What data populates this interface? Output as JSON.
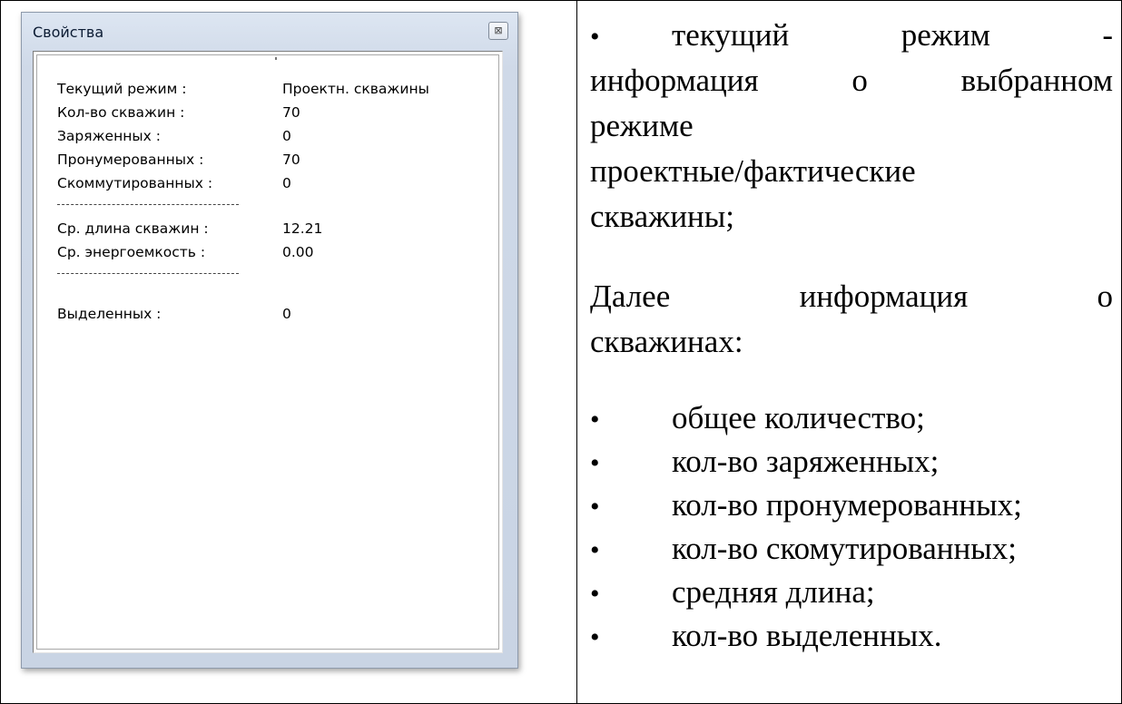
{
  "properties_window": {
    "title": "Свойства",
    "close_label": "⊠",
    "rows": [
      {
        "label": "Текущий режим :",
        "value": "Проектн. скважины"
      },
      {
        "label": "Кол-во скважин :",
        "value": "70"
      },
      {
        "label": "Заряженных :",
        "value": "0"
      },
      {
        "label": "Пронумерованных :",
        "value": "70"
      },
      {
        "label": "Скоммутированных :",
        "value": "0"
      },
      {
        "label": "Ср. длина скважин :",
        "value": "12.21"
      },
      {
        "label": "Ср. энергоемкость :",
        "value": "0.00"
      },
      {
        "label": "Выделенных :",
        "value": "0"
      }
    ],
    "separator_text": "--------------------------------"
  },
  "description": {
    "bullet_symbol": "•",
    "intro_words": [
      "текущий",
      "режим",
      "-"
    ],
    "intro_line2": [
      "информация",
      "о",
      "выбранном"
    ],
    "intro_line3": "режиме",
    "intro_line4": "проектные/фактические",
    "intro_line5": "скважины;",
    "next_line1": [
      "Далее",
      "информация",
      "о"
    ],
    "next_line2": "скважинах:",
    "items": [
      "общее количество;",
      "кол-во заряженных;",
      "кол-во пронумерованных;",
      "кол-во скомутированных;",
      "средняя длина;",
      "кол-во выделенных."
    ]
  }
}
